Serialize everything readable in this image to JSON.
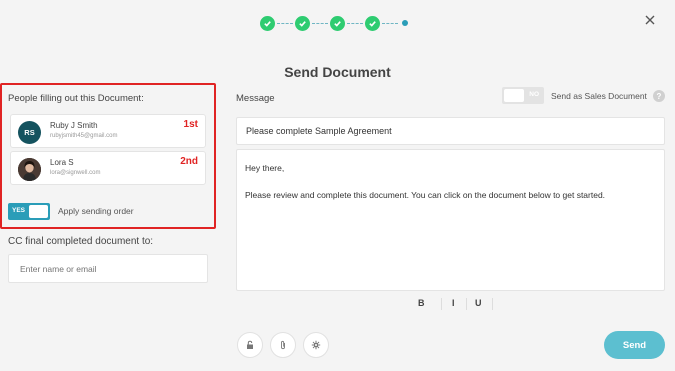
{
  "stepper": {
    "completed_steps": 4,
    "total_steps": 5
  },
  "dialog": {
    "title": "Send Document"
  },
  "people": {
    "label": "People filling out this Document:",
    "signers": [
      {
        "initials": "RS",
        "name": "Ruby J Smith",
        "email": "rubyjsmith45@gmail.com",
        "order": "1st"
      },
      {
        "initials": "",
        "name": "Lora S",
        "email": "lora@signwell.com",
        "order": "2nd"
      }
    ],
    "sending_order_toggle": {
      "state": "YES",
      "label": "Apply sending order"
    }
  },
  "cc": {
    "label": "CC final completed document to:",
    "placeholder": "Enter name or email"
  },
  "message": {
    "label": "Message",
    "sales_toggle": {
      "state": "NO",
      "label": "Send as Sales Document"
    },
    "help": "?",
    "subject": "Please complete Sample Agreement",
    "body": [
      "Hey there,",
      "Please review and complete this document. You can click on the document below to get started."
    ]
  },
  "format": {
    "bold": "B",
    "italic": "I",
    "underline": "U"
  },
  "actions": {
    "send_label": "Send"
  },
  "colors": {
    "accent": "#2a9db8",
    "success": "#2ecc71",
    "highlight": "#e02323",
    "send": "#5cbfd0"
  }
}
